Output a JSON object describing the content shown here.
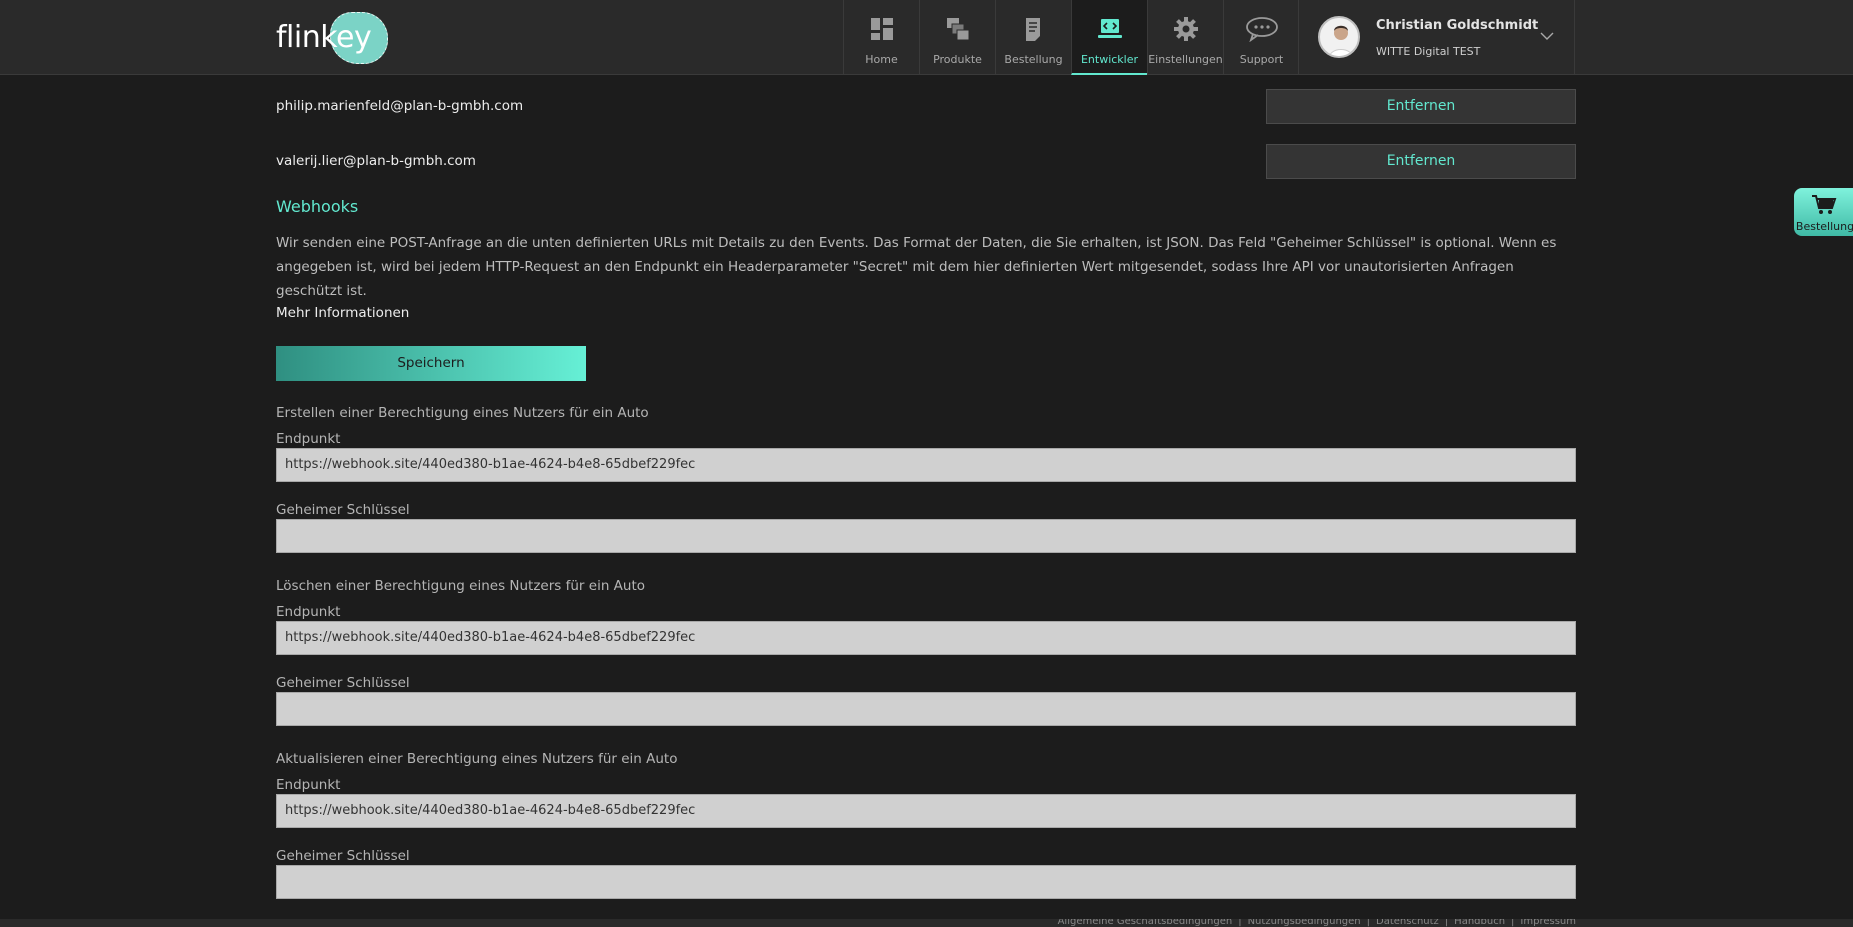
{
  "header": {
    "logo_text": "flinkey",
    "nav": [
      {
        "label": "Home",
        "icon": "dashboard-icon",
        "active": false
      },
      {
        "label": "Produkte",
        "icon": "products-icon",
        "active": false
      },
      {
        "label": "Bestellung",
        "icon": "order-document-icon",
        "active": false
      },
      {
        "label": "Entwickler",
        "icon": "developer-laptop-icon",
        "active": true
      },
      {
        "label": "Einstellungen",
        "icon": "gear-icon",
        "active": false
      },
      {
        "label": "Support",
        "icon": "chat-bubble-icon",
        "active": false
      }
    ],
    "user": {
      "name": "Christian Goldschmidt",
      "org": "WITTE Digital TEST"
    }
  },
  "emails": [
    {
      "address": "philip.marienfeld@plan-b-gmbh.com",
      "button": "Entfernen"
    },
    {
      "address": "valerij.lier@plan-b-gmbh.com",
      "button": "Entfernen"
    }
  ],
  "webhooks": {
    "title": "Webhooks",
    "description": "Wir senden eine POST-Anfrage an die unten definierten URLs mit Details zu den Events. Das Format der Daten, die Sie erhalten, ist JSON. Das Feld \"Geheimer Schlüssel\" is optional. Wenn es angegeben ist, wird bei jedem HTTP-Request an den Endpunkt ein Headerparameter \"Secret\" mit dem hier definierten Wert mitgesendet, sodass Ihre API vor unautorisierten Anfragen geschützt ist.",
    "more_info": "Mehr Informationen",
    "save_label": "Speichern",
    "groups": [
      {
        "title": "Erstellen einer Berechtigung eines Nutzers für ein Auto",
        "endpoint_label": "Endpunkt",
        "endpoint_value": "https://webhook.site/440ed380-b1ae-4624-b4e8-65dbef229fec",
        "secret_label": "Geheimer Schlüssel",
        "secret_value": ""
      },
      {
        "title": "Löschen einer Berechtigung eines Nutzers für ein Auto",
        "endpoint_label": "Endpunkt",
        "endpoint_value": "https://webhook.site/440ed380-b1ae-4624-b4e8-65dbef229fec",
        "secret_label": "Geheimer Schlüssel",
        "secret_value": ""
      },
      {
        "title": "Aktualisieren einer Berechtigung eines Nutzers für ein Auto",
        "endpoint_label": "Endpunkt",
        "endpoint_value": "https://webhook.site/440ed380-b1ae-4624-b4e8-65dbef229fec",
        "secret_label": "Geheimer Schlüssel",
        "secret_value": ""
      }
    ]
  },
  "float_cart": {
    "label": "Bestellung",
    "icon": "cart-icon"
  },
  "footer": {
    "links": [
      "Allgemeine Geschäftsbedingungen",
      "Nutzungsbedingungen",
      "Datenschutz",
      "Handbuch",
      "Impressum"
    ]
  },
  "colors": {
    "accent": "#62e8cf",
    "background": "#1c1c1c",
    "header": "#2a2a2a",
    "field": "#d0d0d0"
  }
}
